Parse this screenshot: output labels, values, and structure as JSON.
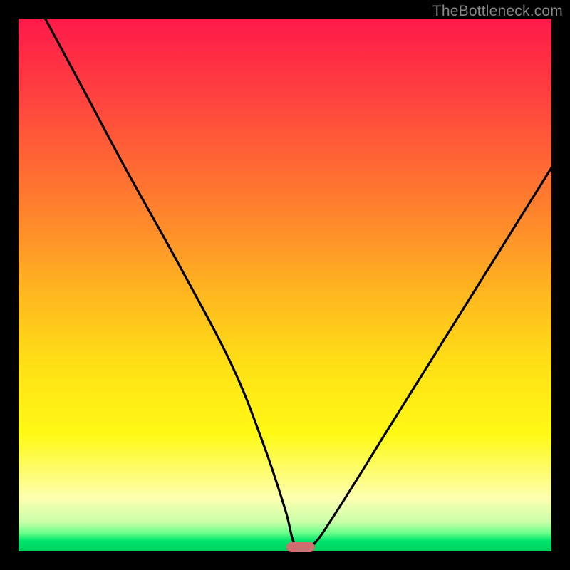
{
  "watermark": "TheBottleneck.com",
  "chart_data": {
    "type": "line",
    "title": "",
    "xlabel": "",
    "ylabel": "",
    "xlim": [
      0,
      100
    ],
    "ylim": [
      0,
      100
    ],
    "series": [
      {
        "name": "bottleneck-curve",
        "x": [
          5,
          12,
          20,
          30,
          40,
          46,
          50,
          52,
          55,
          60,
          70,
          85,
          100
        ],
        "values": [
          100,
          87,
          72,
          54,
          35,
          20,
          8,
          1,
          1,
          8,
          24,
          48,
          72
        ]
      }
    ],
    "marker": {
      "x": 53,
      "y": 0.5,
      "color": "#cc6f70"
    },
    "gradient_stops": [
      {
        "pos": 0,
        "color": "#ff1a4b"
      },
      {
        "pos": 0.5,
        "color": "#ffd020"
      },
      {
        "pos": 0.9,
        "color": "#ffff80"
      },
      {
        "pos": 1.0,
        "color": "#00d060"
      }
    ]
  }
}
